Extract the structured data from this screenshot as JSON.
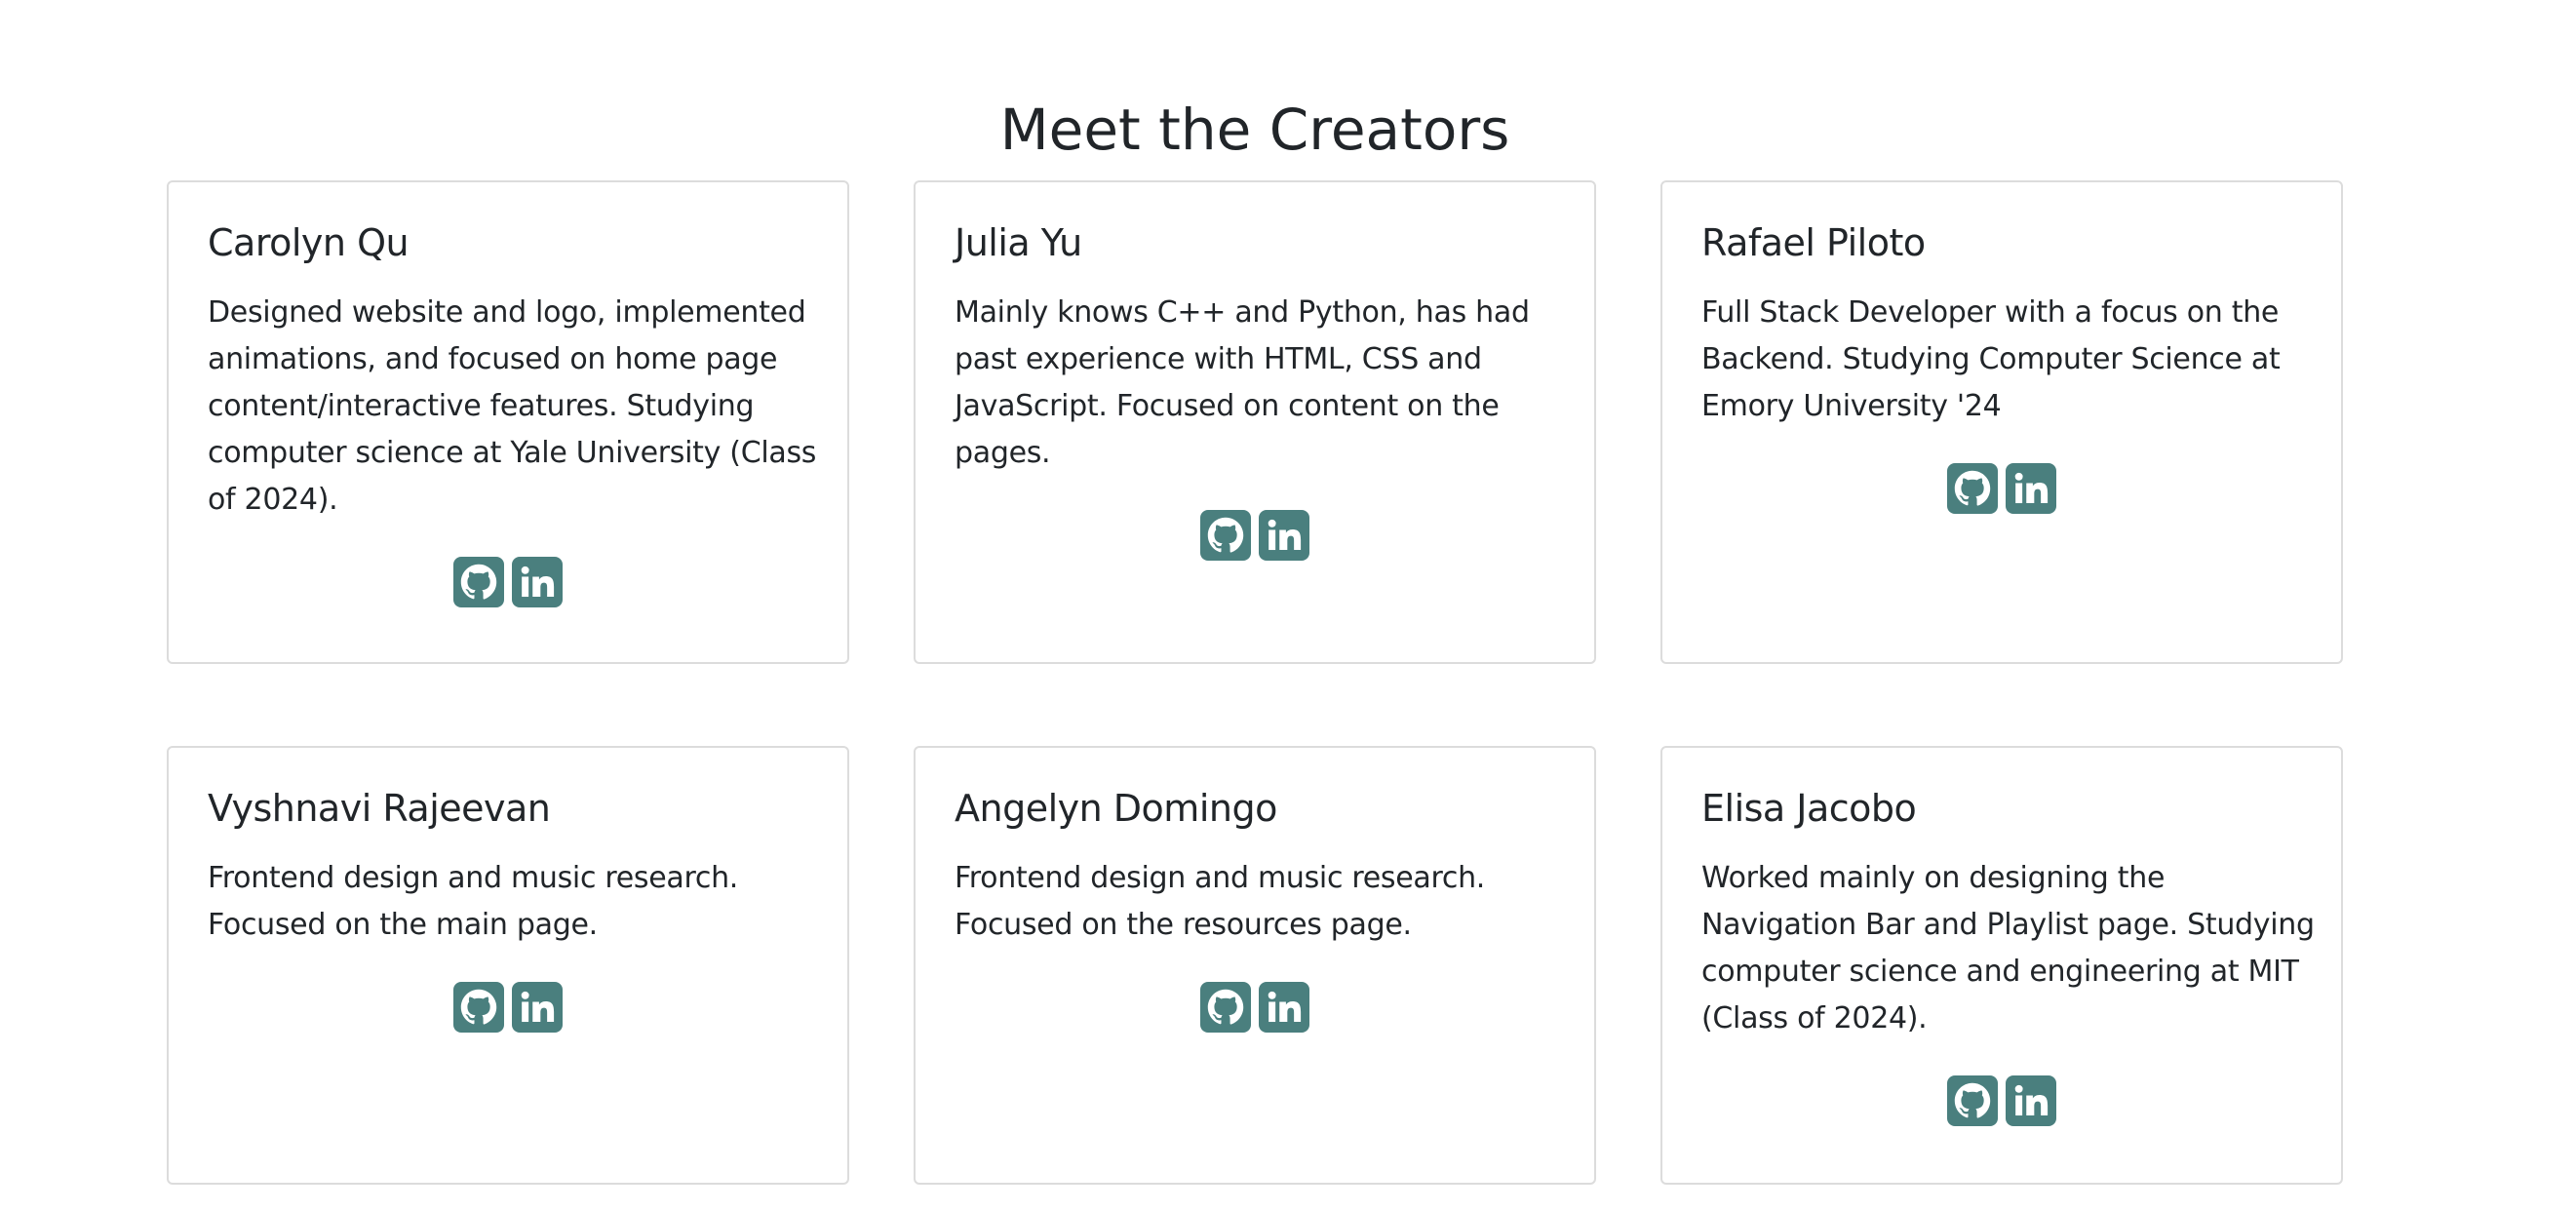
{
  "page": {
    "title": "Meet the Creators"
  },
  "theme": {
    "icon_bg": "#4a7f7e",
    "card_border": "#dcdcdc",
    "text": "#212529"
  },
  "creators": [
    {
      "name": "Carolyn Qu",
      "description": "Designed website and logo, implemented animations, and focused on home page content/interactive features. Studying computer science at Yale University (Class of 2024).",
      "links": [
        "github-icon",
        "linkedin-icon"
      ]
    },
    {
      "name": "Julia Yu",
      "description": "Mainly knows C++ and Python, has had past experience with HTML, CSS and JavaScript. Focused on content on the pages.",
      "links": [
        "github-icon",
        "linkedin-icon"
      ]
    },
    {
      "name": "Rafael Piloto",
      "description": "Full Stack Developer with a focus on the Backend. Studying Computer Science at Emory University '24",
      "links": [
        "github-icon",
        "linkedin-icon"
      ]
    },
    {
      "name": "Vyshnavi Rajeevan",
      "description": "Frontend design and music research. Focused on the main page.",
      "links": [
        "github-icon",
        "linkedin-icon"
      ]
    },
    {
      "name": "Angelyn Domingo",
      "description": "Frontend design and music research. Focused on the resources page.",
      "links": [
        "github-icon",
        "linkedin-icon"
      ]
    },
    {
      "name": "Elisa Jacobo",
      "description": "Worked mainly on designing the Navigation Bar and Playlist page. Studying computer science and engineering at MIT (Class of 2024).",
      "links": [
        "github-icon",
        "linkedin-icon"
      ]
    }
  ]
}
